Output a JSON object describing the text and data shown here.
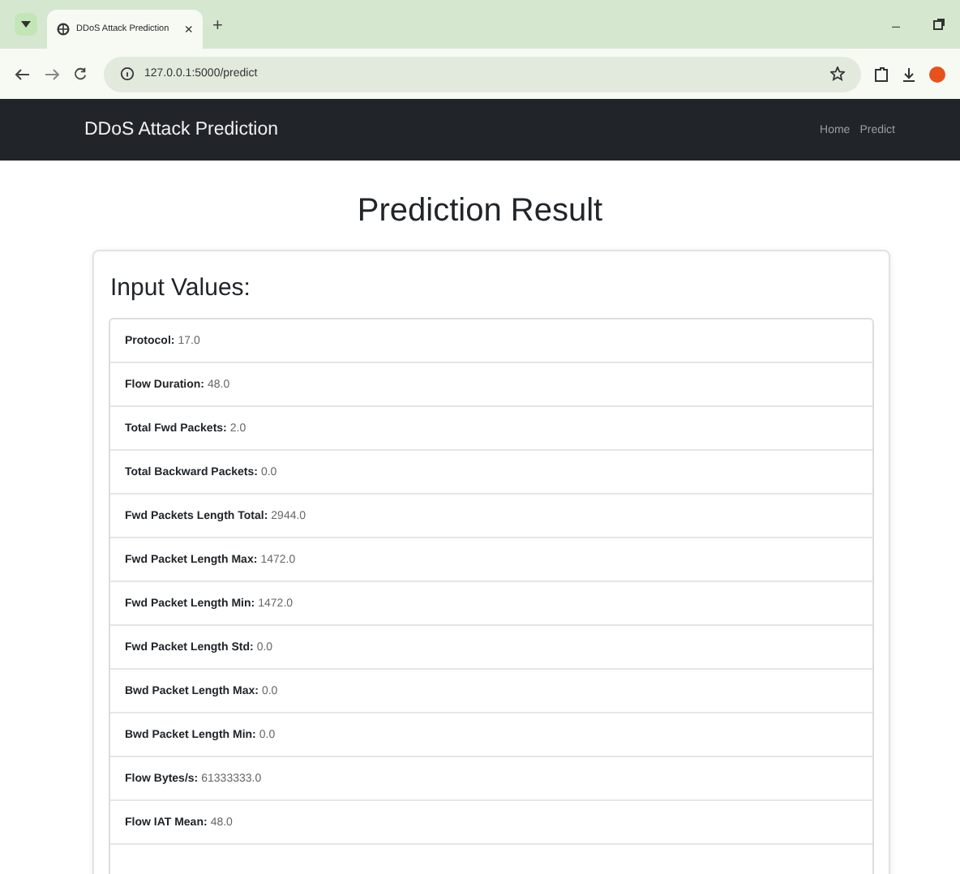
{
  "browser": {
    "tab": {
      "title": "DDoS Attack Prediction",
      "close": "×"
    },
    "new_tab": "+",
    "window_controls": {
      "minimize": "–"
    },
    "url": "127.0.0.1:5000/predict"
  },
  "navbar": {
    "brand": "DDoS Attack Prediction",
    "links": [
      {
        "label": "Home"
      },
      {
        "label": "Predict"
      }
    ]
  },
  "heading": "Prediction Result",
  "card": {
    "title": "Input Values:",
    "items": [
      {
        "label": "Protocol:",
        "value": "17.0"
      },
      {
        "label": "Flow Duration:",
        "value": "48.0"
      },
      {
        "label": "Total Fwd Packets:",
        "value": "2.0"
      },
      {
        "label": "Total Backward Packets:",
        "value": "0.0"
      },
      {
        "label": "Fwd Packets Length Total:",
        "value": "2944.0"
      },
      {
        "label": "Fwd Packet Length Max:",
        "value": "1472.0"
      },
      {
        "label": "Fwd Packet Length Min:",
        "value": "1472.0"
      },
      {
        "label": "Fwd Packet Length Std:",
        "value": "0.0"
      },
      {
        "label": "Bwd Packet Length Max:",
        "value": "0.0"
      },
      {
        "label": "Bwd Packet Length Min:",
        "value": "0.0"
      },
      {
        "label": "Flow Bytes/s:",
        "value": "61333333.0"
      },
      {
        "label": "Flow IAT Mean:",
        "value": "48.0"
      }
    ]
  }
}
